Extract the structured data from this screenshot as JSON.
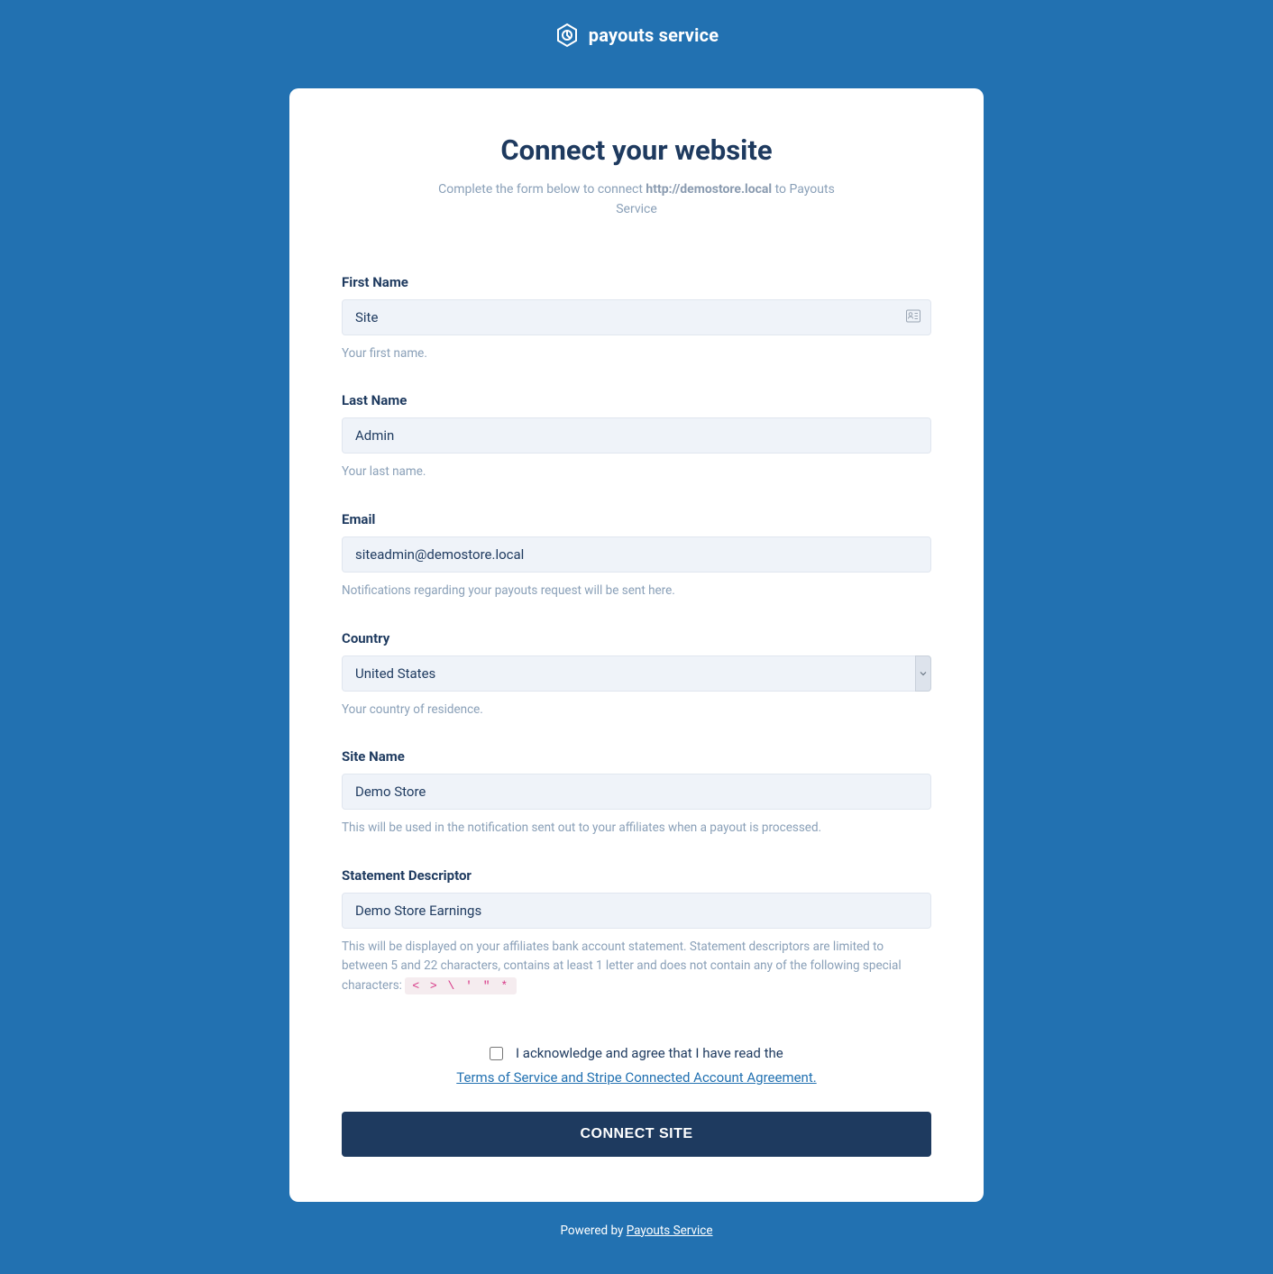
{
  "brand": {
    "name": "payouts service"
  },
  "header": {
    "title": "Connect your website",
    "subtitle_prefix": "Complete the form below to connect ",
    "subtitle_url": "http://demostore.local",
    "subtitle_suffix": " to Payouts Service"
  },
  "form": {
    "first_name": {
      "label": "First Name",
      "value": "Site",
      "hint": "Your first name."
    },
    "last_name": {
      "label": "Last Name",
      "value": "Admin",
      "hint": "Your last name."
    },
    "email": {
      "label": "Email",
      "value": "siteadmin@demostore.local",
      "hint": "Notifications regarding your payouts request will be sent here."
    },
    "country": {
      "label": "Country",
      "value": "United States",
      "hint": "Your country of residence."
    },
    "site_name": {
      "label": "Site Name",
      "value": "Demo Store",
      "hint": "This will be used in the notification sent out to your affiliates when a payout is processed."
    },
    "statement_descriptor": {
      "label": "Statement Descriptor",
      "value": "Demo Store Earnings",
      "hint_prefix": "This will be displayed on your affiliates bank account statement. Statement descriptors are limited to between 5 and 22 characters, contains at least 1 letter and does not contain any of the following special characters: ",
      "hint_code": "< > \\ ' \" *"
    }
  },
  "consent": {
    "text": "I acknowledge and agree that I have read the",
    "link_text": "Terms of Service and Stripe Connected Account Agreement."
  },
  "submit_label": "CONNECT SITE",
  "footer": {
    "prefix": "Powered by ",
    "link": "Payouts Service"
  }
}
